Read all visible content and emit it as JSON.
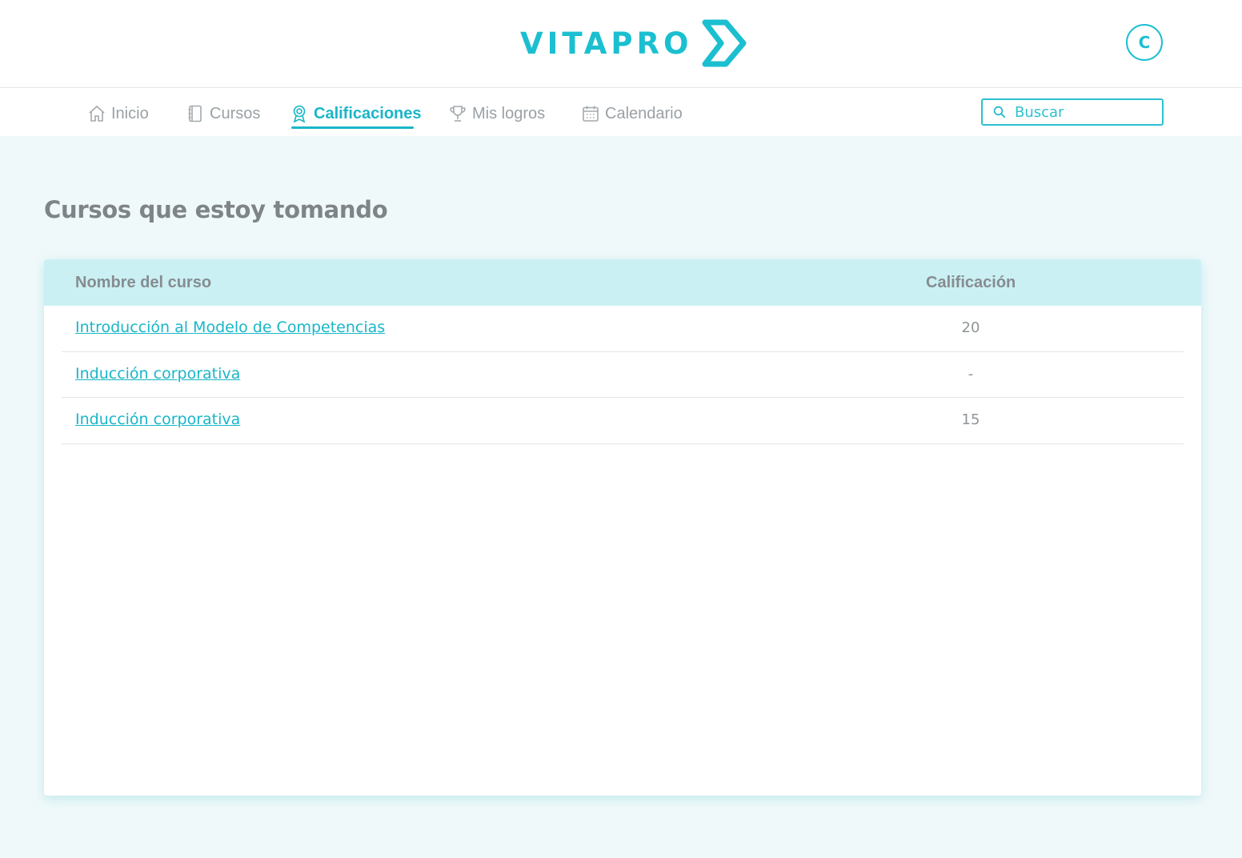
{
  "header": {
    "brand": "VITAPRO",
    "user_initial": "C",
    "colors": {
      "accent": "#1bbfd0",
      "title_gray": "#7e8487",
      "background": "#f0f9fa"
    }
  },
  "nav": {
    "items": [
      {
        "label": "Inicio",
        "icon": "home-icon",
        "active": false
      },
      {
        "label": "Cursos",
        "icon": "notebook-icon",
        "active": false
      },
      {
        "label": "Calificaciones",
        "icon": "award-icon",
        "active": true
      },
      {
        "label": "Mis logros",
        "icon": "trophy-icon",
        "active": false
      },
      {
        "label": "Calendario",
        "icon": "calendar-icon",
        "active": false
      }
    ],
    "search": {
      "placeholder": "Buscar",
      "value": ""
    }
  },
  "main": {
    "title": "Cursos que estoy tomando",
    "table": {
      "headers": {
        "name": "Nombre del curso",
        "grade": "Calificación"
      },
      "rows": [
        {
          "name": "Introducción al Modelo de Competencias",
          "grade": "20"
        },
        {
          "name": "Inducción corporativa",
          "grade": "-"
        },
        {
          "name": "Inducción corporativa",
          "grade": "15"
        }
      ]
    }
  }
}
